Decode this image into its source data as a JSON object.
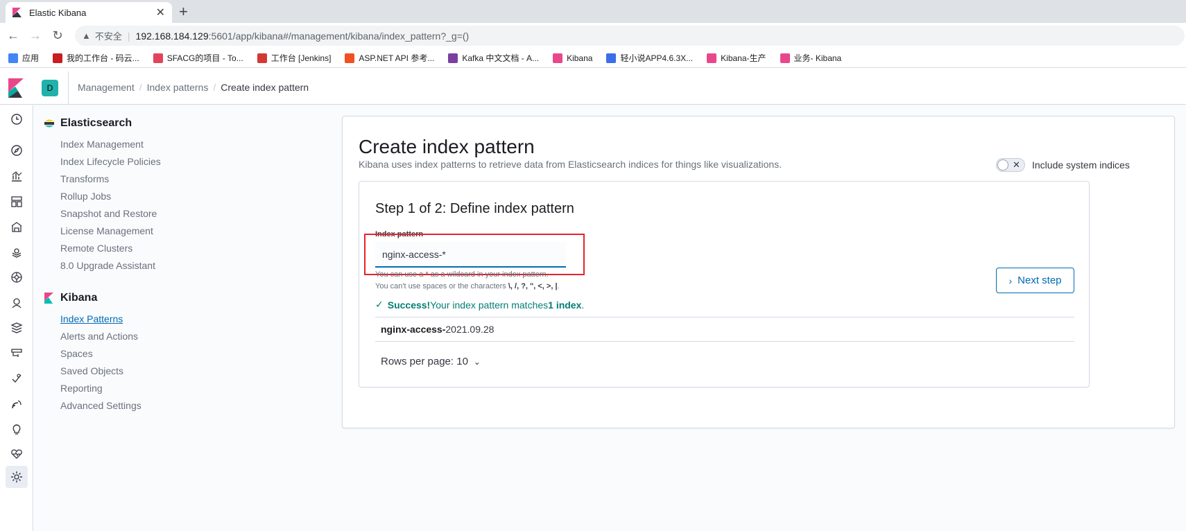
{
  "browser": {
    "tab_title": "Elastic Kibana",
    "tab_close": "✕",
    "new_tab": "+",
    "address": {
      "insecure_label": "不安全",
      "separator": "|",
      "host": "192.168.184.129",
      "path": ":5601/app/kibana#/management/kibana/index_pattern?_g=()"
    },
    "bookmarks": [
      {
        "label": "应用",
        "icon": "apps-grid-icon",
        "color": "#4285f4"
      },
      {
        "label": "我的工作台 - 码云...",
        "icon": "gitee-icon",
        "color": "#c71d23"
      },
      {
        "label": "SFACG的项目 - To...",
        "icon": "tower-icon",
        "color": "#e2445c"
      },
      {
        "label": "工作台 [Jenkins]",
        "icon": "jenkins-icon",
        "color": "#d33833"
      },
      {
        "label": "ASP.NET API 参考...",
        "icon": "microsoft-icon",
        "color": "#f25022"
      },
      {
        "label": "Kafka 中文文档 - A...",
        "icon": "feather-icon",
        "color": "#7b3fa0"
      },
      {
        "label": "Kibana",
        "icon": "kibana-icon",
        "color": "#e8488b"
      },
      {
        "label": "轻小说APP4.6.3X...",
        "icon": "bot-icon",
        "color": "#3b6ee8"
      },
      {
        "label": "Kibana-生产",
        "icon": "kibana-icon",
        "color": "#e8488b"
      },
      {
        "label": "业务- Kibana",
        "icon": "kibana-icon",
        "color": "#e8488b"
      }
    ]
  },
  "header": {
    "space_initial": "D",
    "breadcrumbs": [
      "Management",
      "Index patterns",
      "Create index pattern"
    ]
  },
  "sidebar": {
    "elasticsearch": {
      "title": "Elasticsearch",
      "items": [
        "Index Management",
        "Index Lifecycle Policies",
        "Transforms",
        "Rollup Jobs",
        "Snapshot and Restore",
        "License Management",
        "Remote Clusters",
        "8.0 Upgrade Assistant"
      ]
    },
    "kibana": {
      "title": "Kibana",
      "items": [
        "Index Patterns",
        "Alerts and Actions",
        "Spaces",
        "Saved Objects",
        "Reporting",
        "Advanced Settings"
      ],
      "active_index": 0
    }
  },
  "page": {
    "title": "Create index pattern",
    "description": "Kibana uses index patterns to retrieve data from Elasticsearch indices for things like visualizations.",
    "toggle_label": "Include system indices",
    "toggle_on": false
  },
  "step": {
    "title": "Step 1 of 2: Define index pattern",
    "field_label": "Index pattern",
    "field_value": "nginx-access-*",
    "help1": "You can use a * as a wildcard in your index pattern.",
    "help2_prefix": "You can't use spaces or the characters ",
    "help2_chars": "\\, /, ?, \", <, >, |",
    "help2_suffix": ".",
    "success_strong": "Success!",
    "success_text": " Your index pattern matches ",
    "success_count": "1 index",
    "success_end": ".",
    "match_bold": "nginx-access-",
    "match_rest": "2021.09.28",
    "rows_per_page": "Rows per page: 10",
    "next_button": "Next step"
  },
  "colors": {
    "accent": "#006bb4",
    "success": "#017d73",
    "highlight": "#e5222a",
    "space_badge": "#20b2aa"
  }
}
